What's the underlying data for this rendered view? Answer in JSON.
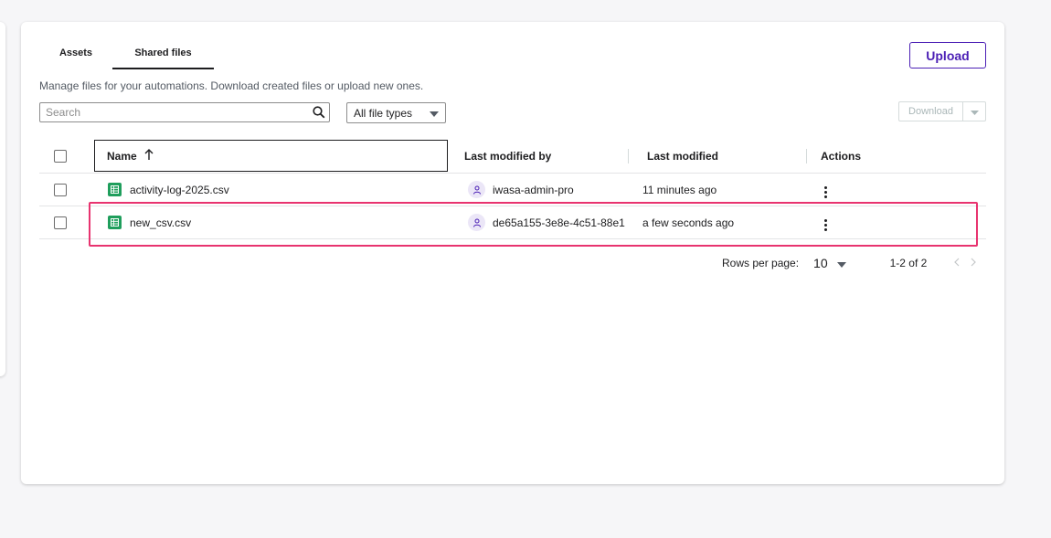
{
  "tabs": [
    {
      "label": "Assets"
    },
    {
      "label": "Shared files"
    }
  ],
  "upload_label": "Upload",
  "description": "Manage files for your automations. Download created files or upload new ones.",
  "search": {
    "placeholder": "Search"
  },
  "file_filter": {
    "selected": "All file types"
  },
  "download_label": "Download",
  "table": {
    "columns": {
      "name": "Name",
      "modified_by": "Last modified by",
      "modified": "Last modified",
      "actions": "Actions"
    },
    "rows": [
      {
        "name": "activity-log-2025.csv",
        "modified_by": "iwasa-admin-pro",
        "modified": "11 minutes ago"
      },
      {
        "name": "new_csv.csv",
        "modified_by": "de65a155-3e8e-4c51-88e1",
        "modified": "a few seconds ago"
      }
    ]
  },
  "pagination": {
    "rows_per_page_label": "Rows per page:",
    "rows_per_page": "10",
    "range": "1-2 of 2"
  },
  "colors": {
    "accent": "#4b1fb5",
    "highlight": "#e8336f",
    "file_icon": "#1f9e5c"
  }
}
